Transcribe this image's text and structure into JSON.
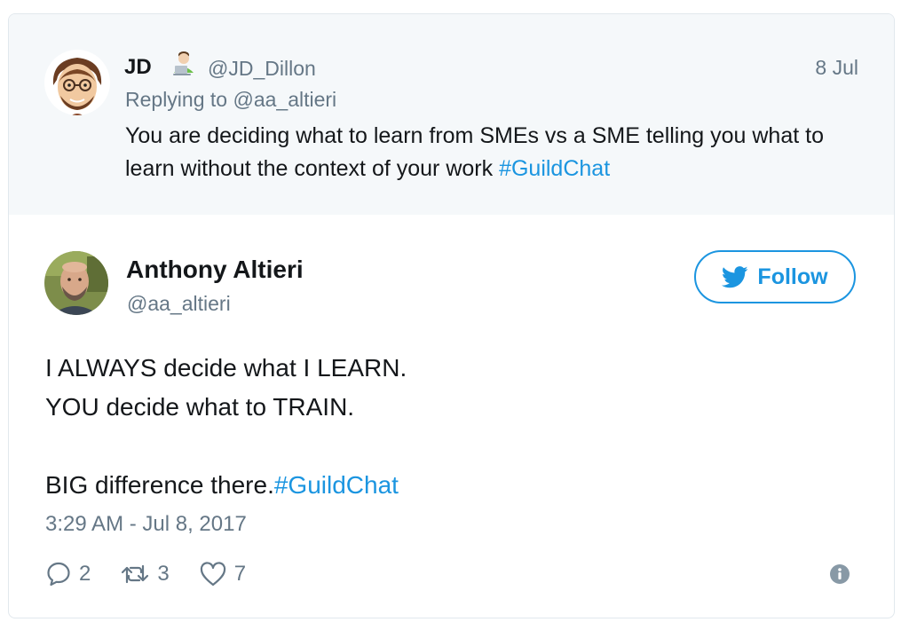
{
  "parent_tweet": {
    "display_name": "JD",
    "emoji": "laptop-technologist-emoji",
    "handle": "@JD_Dillon",
    "date": "8 Jul",
    "replying_prefix": "Replying to",
    "replying_handle": "@aa_altieri",
    "text": "You are deciding what to learn from SMEs vs a SME telling you what to learn without the context of your work",
    "hashtag": "#GuildChat"
  },
  "main_tweet": {
    "display_name": "Anthony Altieri",
    "handle": "@aa_altieri",
    "follow_label": "Follow",
    "lines": [
      "I ALWAYS decide what I LEARN.",
      "YOU decide what to TRAIN."
    ],
    "last_line_text": "BIG difference there.",
    "hashtag": "#GuildChat",
    "timestamp": "3:29 AM - Jul 8, 2017",
    "actions": {
      "reply_count": "2",
      "retweet_count": "3",
      "like_count": "7"
    }
  },
  "colors": {
    "accent": "#1b95e0",
    "secondary_text": "#657786",
    "parent_background": "#f5f8fa",
    "border": "#e1e8ed"
  },
  "icons": [
    "twitter-bird-icon",
    "reply-icon",
    "retweet-icon",
    "heart-icon",
    "info-icon"
  ]
}
